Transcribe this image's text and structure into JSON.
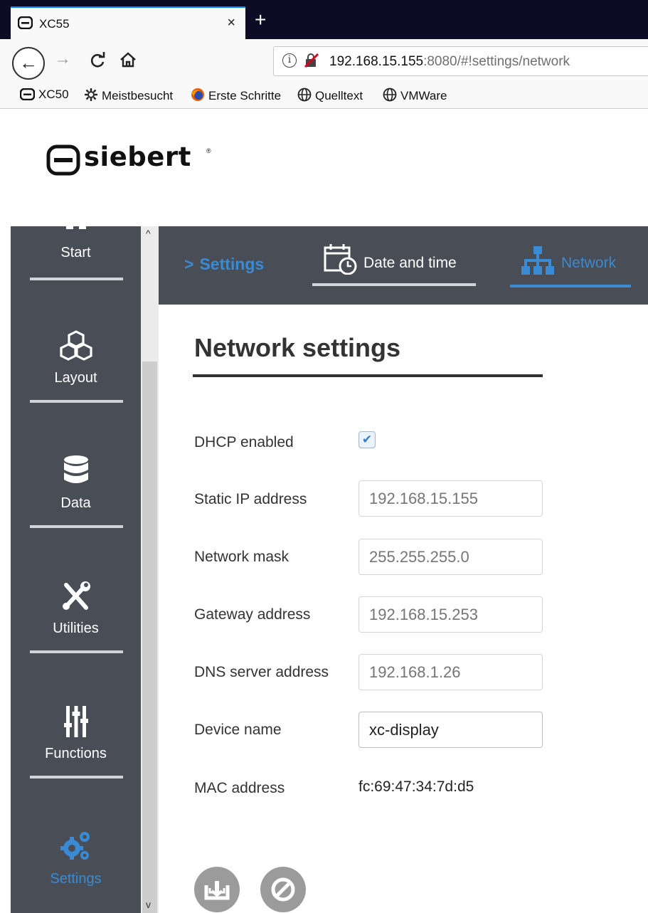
{
  "browser": {
    "tab_title": "XC55",
    "tab_close": "×",
    "new_tab": "+",
    "back": "←",
    "forward": "→",
    "reload": "C",
    "home": "⌂",
    "info_icon": "i",
    "url_host": "192.168.15.155",
    "url_rest": ":8080/#!settings/network",
    "bookmarks": [
      "XC50",
      "Meistbesucht",
      "Erste Schritte",
      "Quelltext",
      "VMWare"
    ]
  },
  "header": {
    "logo_text": "siebert",
    "logo_reg": "®"
  },
  "sidebar": {
    "items": [
      {
        "label": "Start",
        "icon": "home-icon"
      },
      {
        "label": "Layout",
        "icon": "cubes-icon"
      },
      {
        "label": "Data",
        "icon": "database-icon"
      },
      {
        "label": "Utilities",
        "icon": "tools-icon"
      },
      {
        "label": "Functions",
        "icon": "sliders-icon"
      },
      {
        "label": "Settings",
        "icon": "gears-icon",
        "active": true
      }
    ],
    "scroll_up": "^",
    "scroll_down": "v"
  },
  "topnav": {
    "breadcrumb": "Settings",
    "breadcrumb_arrow": ">",
    "tabs": [
      {
        "label": "Date and time",
        "icon": "calendar-clock-icon"
      },
      {
        "label": "Network",
        "icon": "network-icon",
        "active": true
      }
    ]
  },
  "form": {
    "title": "Network settings",
    "dhcp_label": "DHCP enabled",
    "dhcp_checked": true,
    "dhcp_check": "✔",
    "static_ip_label": "Static IP address",
    "static_ip_placeholder": "192.168.15.155",
    "netmask_label": "Network mask",
    "netmask_placeholder": "255.255.255.0",
    "gateway_label": "Gateway address",
    "gateway_placeholder": "192.168.15.253",
    "dns_label": "DNS server address",
    "dns_placeholder": "192.168.1.26",
    "device_name_label": "Device name",
    "device_name_value": "xc-display",
    "mac_label": "MAC address",
    "mac_value": "fc:69:47:34:7d:d5"
  },
  "colors": {
    "sidebar_bg": "#484d56",
    "accent": "#3a8bd3",
    "rule": "#d0d3d8",
    "button_grey": "#9b9b9b"
  }
}
